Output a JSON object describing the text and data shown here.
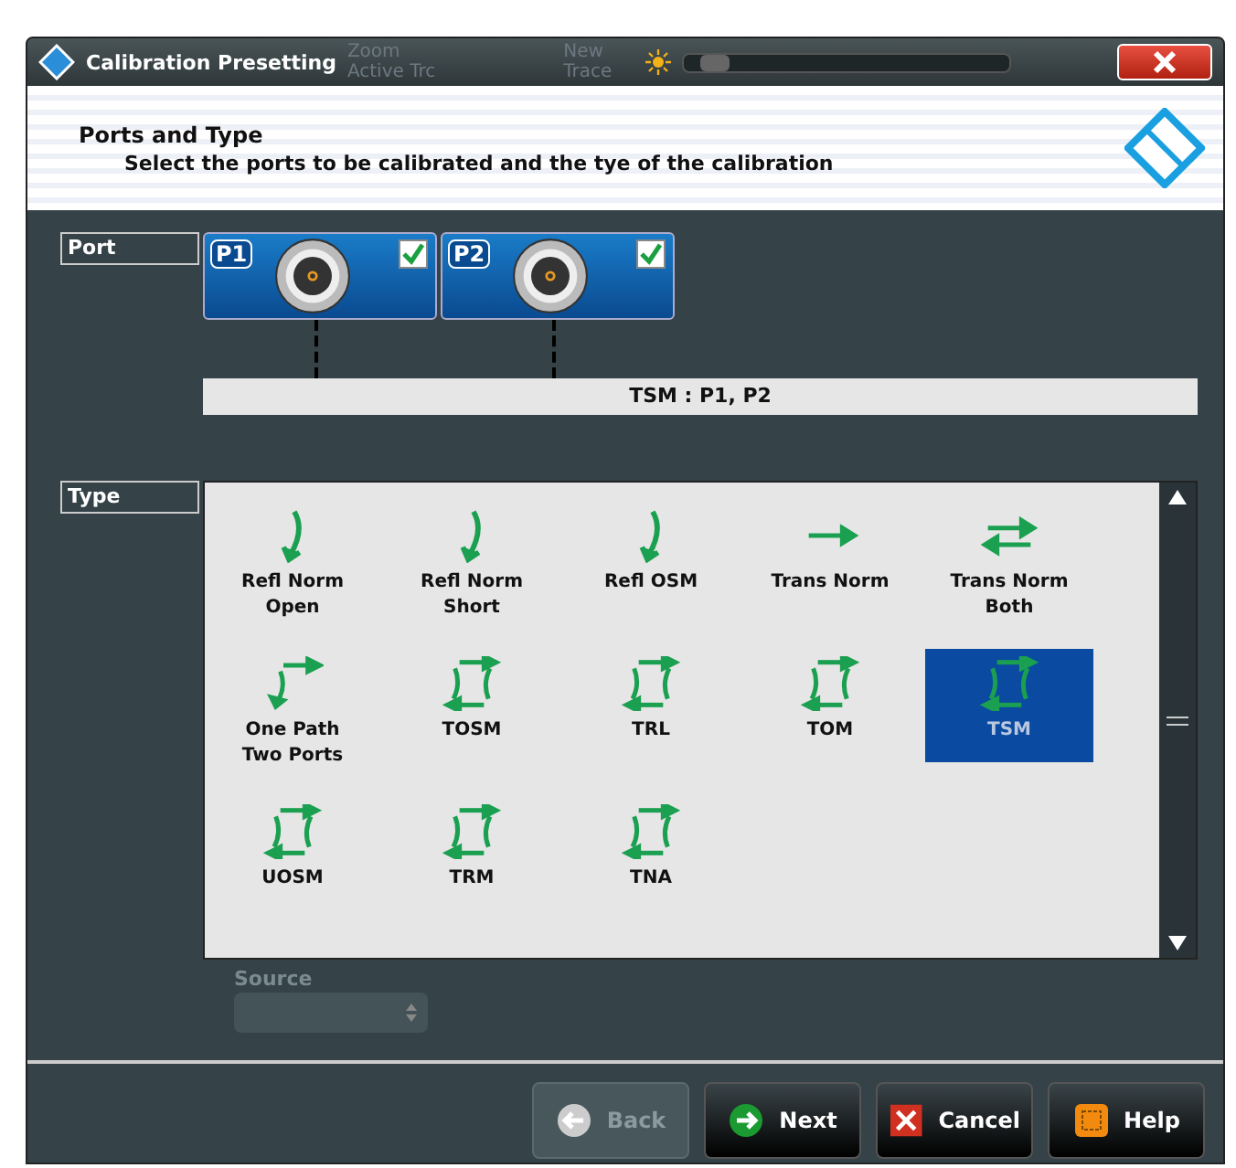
{
  "window": {
    "title": "Calibration Presetting",
    "background_toolbar": [
      "Zoom",
      "Active Trc",
      "New",
      "Trace"
    ],
    "brightness": {
      "level": 0.05
    }
  },
  "header": {
    "title": "Ports and Type",
    "subtitle": "Select the ports to be calibrated and the tye of the calibration"
  },
  "port_section": {
    "label": "Port",
    "ports": [
      {
        "label": "P1",
        "checked": true
      },
      {
        "label": "P2",
        "checked": true
      }
    ],
    "summary": "TSM : P1, P2"
  },
  "type_section": {
    "label": "Type",
    "types": [
      {
        "label": "Refl Norm Open",
        "kind": "refl",
        "selected": false
      },
      {
        "label": "Refl Norm Short",
        "kind": "refl",
        "selected": false
      },
      {
        "label": "Refl OSM",
        "kind": "refl",
        "selected": false
      },
      {
        "label": "Trans Norm",
        "kind": "trans",
        "selected": false
      },
      {
        "label": "Trans Norm Both",
        "kind": "both",
        "selected": false
      },
      {
        "label": "One Path Two Ports",
        "kind": "onepath",
        "selected": false
      },
      {
        "label": "TOSM",
        "kind": "full",
        "selected": false
      },
      {
        "label": "TRL",
        "kind": "full",
        "selected": false
      },
      {
        "label": "TOM",
        "kind": "full",
        "selected": false
      },
      {
        "label": "TSM",
        "kind": "full",
        "selected": true
      },
      {
        "label": "UOSM",
        "kind": "full",
        "selected": false
      },
      {
        "label": "TRM",
        "kind": "full",
        "selected": false
      },
      {
        "label": "TNA",
        "kind": "full",
        "selected": false
      }
    ]
  },
  "source": {
    "label": "Source",
    "disabled": true
  },
  "buttons": [
    {
      "label": "Back",
      "kind": "back",
      "disabled": true
    },
    {
      "label": "Next",
      "kind": "next",
      "disabled": false
    },
    {
      "label": "Cancel",
      "kind": "cancel",
      "disabled": false
    },
    {
      "label": "Help",
      "kind": "help",
      "disabled": false
    }
  ]
}
